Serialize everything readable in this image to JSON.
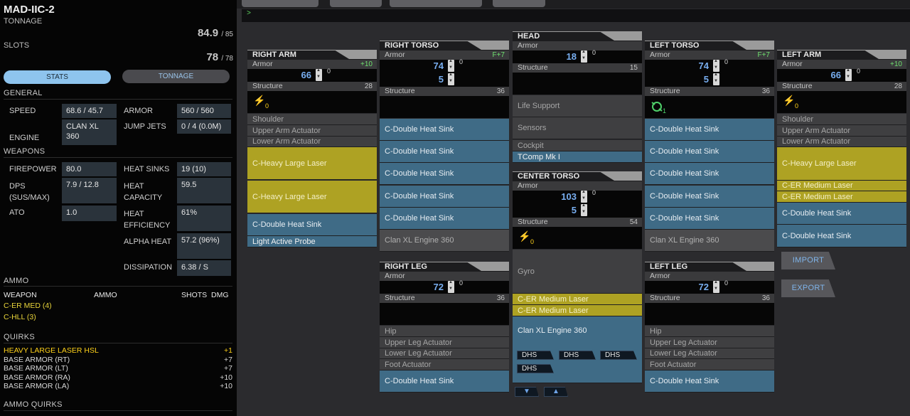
{
  "mech": {
    "name": "MAD-IIC-2"
  },
  "summary": {
    "tonnage_label": "TONNAGE",
    "tonnage_value": "84.9",
    "tonnage_max": "/ 85",
    "slots_label": "SLOTS",
    "slots_value": "78",
    "slots_max": "/ 78"
  },
  "tabs": {
    "stats": "STATS",
    "tonnage": "TONNAGE"
  },
  "general": {
    "header": "GENERAL",
    "speed_label": "SPEED",
    "speed_value": "68.6 / 45.7",
    "armor_label": "ARMOR",
    "armor_value": "560 / 560",
    "engine_label": "ENGINE",
    "engine_value": "CLAN XL 360",
    "jumpjets_label": "JUMP JETS",
    "jumpjets_value": "0 / 4 (0.0M)"
  },
  "weapons": {
    "header": "WEAPONS",
    "firepower_label": "FIREPOWER",
    "firepower_value": "80.0",
    "heatsinks_label": "HEAT SINKS",
    "heatsinks_value": "19 (10)",
    "dps_label": "DPS (SUS/MAX)",
    "dps_value": "7.9 / 12.8",
    "heatcap_label": "HEAT CAPACITY",
    "heatcap_value": "59.5",
    "ato_label": "ATO",
    "ato_value": "1.0",
    "heateff_label": "HEAT EFFICIENCY",
    "heateff_value": "61%",
    "alpha_label": "ALPHA HEAT",
    "alpha_value": "57.2 (96%)",
    "dissip_label": "DISSIPATION",
    "dissip_value": "6.38 / S"
  },
  "ammo": {
    "header": "AMMO",
    "col_weapon": "WEAPON",
    "col_ammo": "AMMO",
    "col_shots": "SHOTS",
    "col_dmg": "DMG",
    "rows": [
      "C-ER MED (4)",
      "C-HLL (3)"
    ]
  },
  "quirks": {
    "header": "QUIRKS",
    "items": [
      {
        "name": "HEAVY LARGE LASER HSL",
        "value": "+1"
      },
      {
        "name": "BASE ARMOR (RT)",
        "value": "+7"
      },
      {
        "name": "BASE ARMOR (LT)",
        "value": "+7"
      },
      {
        "name": "BASE ARMOR (RA)",
        "value": "+10"
      },
      {
        "name": "BASE ARMOR (LA)",
        "value": "+10"
      }
    ]
  },
  "ammo_quirks": {
    "header": "AMMO QUIRKS"
  },
  "cmd": {
    "prompt": ">"
  },
  "labels": {
    "armor": "Armor",
    "structure": "Structure"
  },
  "right_arm": {
    "title": "RIGHT ARM",
    "quirk": "+10",
    "armor": "66",
    "structure": "28",
    "jumpjets": "0",
    "slots": [
      "Shoulder",
      "Upper Arm Actuator",
      "Lower Arm Actuator",
      "C-Heavy Large Laser",
      "C-Heavy Large Laser",
      "C-Double Heat Sink",
      "Light Active Probe"
    ]
  },
  "right_torso": {
    "title": "RIGHT TORSO",
    "quirk": "F+7",
    "armor_front": "74",
    "armor_rear": "5",
    "structure": "36",
    "slots": [
      "C-Double Heat Sink",
      "C-Double Heat Sink",
      "C-Double Heat Sink",
      "C-Double Heat Sink",
      "C-Double Heat Sink",
      "Clan XL Engine 360"
    ]
  },
  "head": {
    "title": "HEAD",
    "armor": "18",
    "structure": "15",
    "slots": [
      "Life Support",
      "Sensors",
      "Cockpit",
      "TComp Mk I"
    ]
  },
  "center_torso": {
    "title": "CENTER TORSO",
    "armor_front": "103",
    "armor_rear": "5",
    "structure": "54",
    "jumpjets": "0",
    "slots": [
      "Gyro",
      "C-ER Medium Laser",
      "C-ER Medium Laser",
      "Clan XL Engine 360"
    ],
    "dhs": [
      "DHS",
      "DHS",
      "DHS",
      "DHS"
    ]
  },
  "left_torso": {
    "title": "LEFT TORSO",
    "quirk": "F+7",
    "armor_front": "74",
    "armor_rear": "5",
    "structure": "36",
    "ecm": "1",
    "slots": [
      "C-Double Heat Sink",
      "C-Double Heat Sink",
      "C-Double Heat Sink",
      "C-Double Heat Sink",
      "C-Double Heat Sink",
      "Clan XL Engine 360"
    ]
  },
  "left_arm": {
    "title": "LEFT ARM",
    "quirk": "+10",
    "armor": "66",
    "structure": "28",
    "jumpjets": "0",
    "slots": [
      "Shoulder",
      "Upper Arm Actuator",
      "Lower Arm Actuator",
      "C-Heavy Large Laser",
      "C-ER Medium Laser",
      "C-ER Medium Laser",
      "C-Double Heat Sink",
      "C-Double Heat Sink"
    ]
  },
  "right_leg": {
    "title": "RIGHT LEG",
    "armor": "72",
    "structure": "36",
    "slots": [
      "Hip",
      "Upper Leg Actuator",
      "Lower Leg Actuator",
      "Foot Actuator",
      "C-Double Heat Sink"
    ]
  },
  "left_leg": {
    "title": "LEFT LEG",
    "armor": "72",
    "structure": "36",
    "slots": [
      "Hip",
      "Upper Leg Actuator",
      "Lower Leg Actuator",
      "Foot Actuator",
      "C-Double Heat Sink"
    ]
  },
  "actions": {
    "import": "IMPORT",
    "export": "EXPORT"
  },
  "colors": {
    "heat_sink": "#3f6b86",
    "laser": "#aea223",
    "empty": "#3f3f41",
    "armor_value": "#78aef0",
    "quirk_positive": "#6fe06f",
    "highlight_quirk": "#ffd21a"
  }
}
